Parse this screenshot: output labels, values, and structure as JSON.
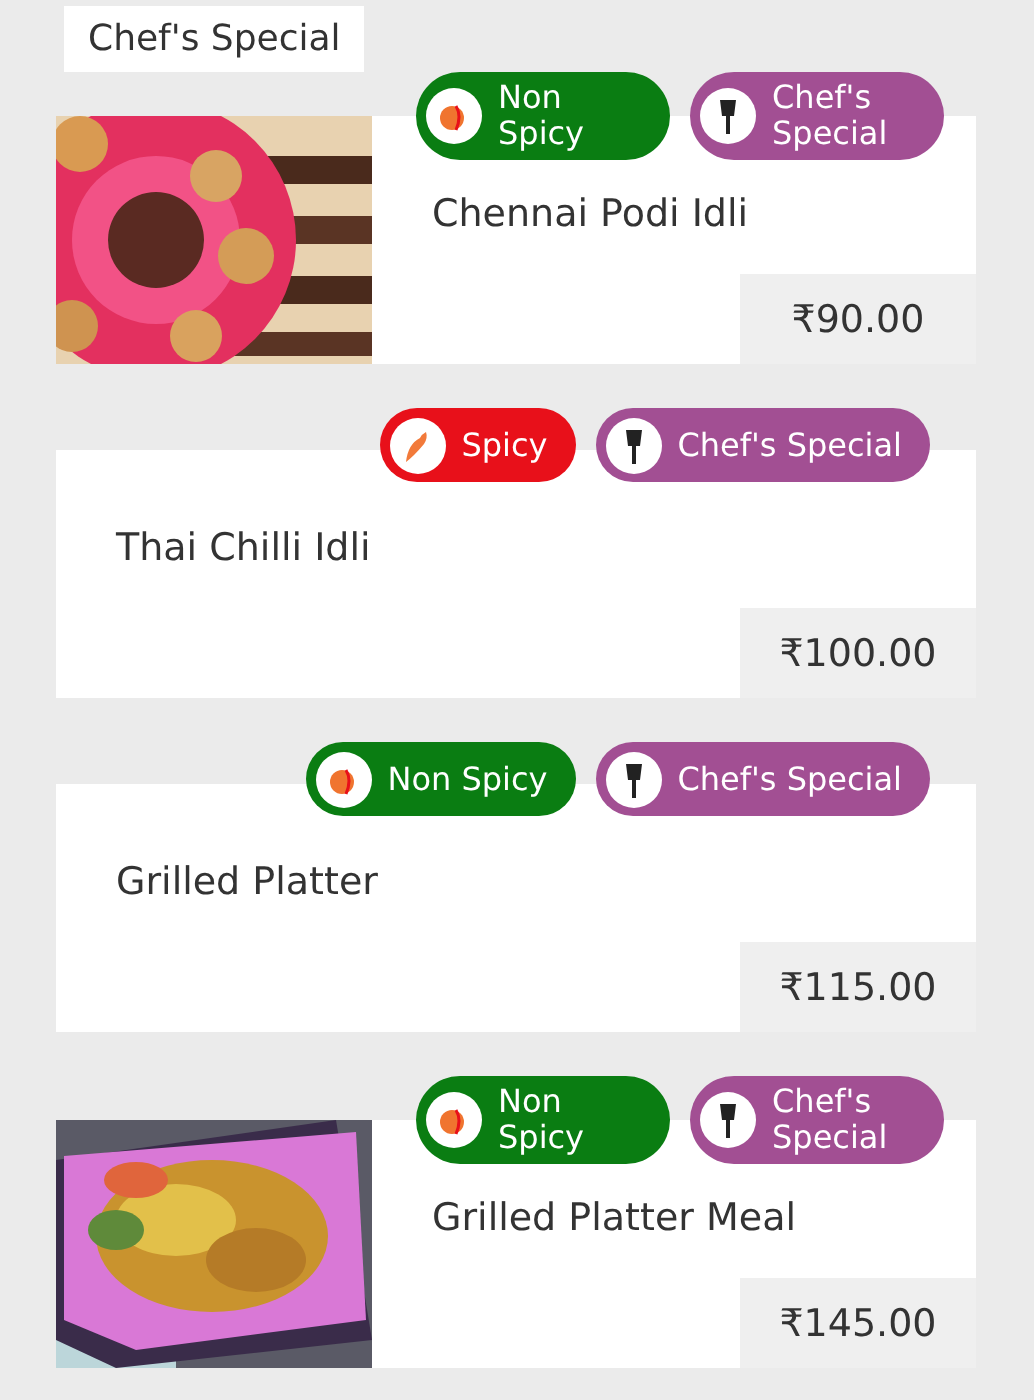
{
  "section_title": "Chef's Special",
  "items": [
    {
      "name": "Chennai Podi Idli",
      "price": "₹90.00",
      "badges": [
        {
          "kind": "non_spicy",
          "label": "Non Spicy"
        },
        {
          "kind": "chef_special",
          "label": "Chef's Special"
        }
      ]
    },
    {
      "name": "Thai Chilli Idli",
      "price": "₹100.00",
      "badges": [
        {
          "kind": "spicy",
          "label": "Spicy"
        },
        {
          "kind": "chef_special",
          "label": "Chef's Special"
        }
      ]
    },
    {
      "name": "Grilled Platter",
      "price": "₹115.00",
      "badges": [
        {
          "kind": "non_spicy",
          "label": "Non Spicy"
        },
        {
          "kind": "chef_special",
          "label": "Chef's Special"
        }
      ]
    },
    {
      "name": "Grilled Platter Meal",
      "price": "₹145.00",
      "badges": [
        {
          "kind": "non_spicy",
          "label": "Non Spicy"
        },
        {
          "kind": "chef_special",
          "label": "Chef's Special"
        }
      ]
    }
  ]
}
